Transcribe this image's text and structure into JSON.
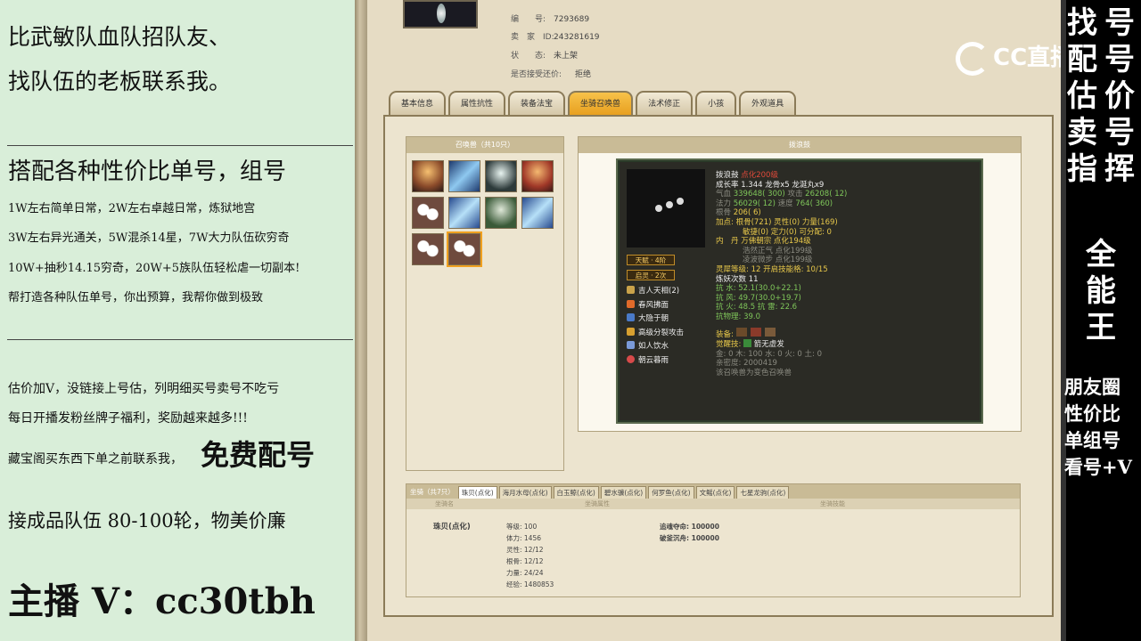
{
  "left_panel": {
    "line1": "比武敏队血队招队友、",
    "line2": "找队伍的老板联系我。",
    "section2_title": "搭配各种性价比单号，组号",
    "s2_l1": "1W左右简单日常，2W左右卓越日常，炼狱地宫",
    "s2_l2": "3W左右异光通关，5W混杀14星，7W大力队伍砍穷奇",
    "s2_l3": "10W+抽秒14.15穷奇，20W+5族队伍轻松虐一切副本!",
    "s2_l4": "帮打造各种队伍单号，你出预算，我帮你做到极致",
    "s3_l1": "估价加V，没链接上号估，列明细买号卖号不吃亏",
    "s3_l2": "每日开播发粉丝牌子福利，奖励越来越多!!!",
    "s3_l3a": "藏宝阁买东西下单之前联系我，",
    "s3_l3b": "免费配号",
    "s3_l4": "接成品队伍 80-100轮，物美价廉",
    "host": "主播 V：cc30tbh"
  },
  "game": {
    "info": [
      {
        "k": "编　　号:",
        "v": "7293689"
      },
      {
        "k": "卖　家　ID:",
        "v": "243281619"
      },
      {
        "k": "状　　态:",
        "v": "未上架"
      },
      {
        "k": "是否接受还价:",
        "v": "拒绝"
      }
    ],
    "tabs": [
      "基本信息",
      "属性抗性",
      "装备法宝",
      "坐骑召唤兽",
      "法术修正",
      "小孩",
      "外观道具"
    ],
    "pets_title": "召唤兽（共10只）",
    "detail_title": "拨浪鼓",
    "card": {
      "name": "拨浪鼓",
      "tag": "点化200级",
      "growth": "成长率 1.344  龙骨x5  龙涎丸x9",
      "hp_label": "气血",
      "hp": "339648( 300)",
      "atk_label": "攻击",
      "atk": "26208( 12)",
      "mp_label": "法力",
      "mp": "56029( 12)",
      "spd_label": "速度",
      "spd": "764( 360)",
      "int_label": "根骨",
      "int": "206( 6)",
      "points": "加点:   根骨(721) 灵性(0) 力量(169)",
      "points2": "敏捷(0) 定力(0) 可分配: 0",
      "inner": "内　丹  万佛朝宗 点化194级",
      "inner2": "浩然正气 点化199级",
      "inner3": "凌波微步 点化199级",
      "lingxi": "灵犀等级:   12  开启技能格:  10/15",
      "refine": "炼妖次数  11",
      "res1": "抗  水: 52.1(30.0+22.1)",
      "res2": "抗  风: 49.7(30.0+19.7)",
      "res3": "抗  火: 48.5  抗  雷: 22.6",
      "res4": "抗物理: 39.0",
      "equip_label": "装备:",
      "awake_label": "觉醒技:",
      "awake": "箭无虚发",
      "elements": "金: 0  木: 100  水: 0  火: 0  土: 0",
      "family": "亲密度: 2000419",
      "note": "该召唤兽为变色召唤兽",
      "chip1": "天赋 · 4阶",
      "chip2": "启灵 · 2次",
      "skills": [
        "吉人天相(2)",
        "春风拂面",
        "大隐于朝",
        "高级分裂攻击",
        "如人饮水",
        "朝云暮雨"
      ]
    },
    "mount": {
      "label": "坐骑（共7只）",
      "tabs": [
        "珠贝(点化)",
        "海月水母(点化)",
        "白玉鲸(点化)",
        "碧水骥(点化)",
        "何罗鱼(点化)",
        "文鳐(点化)",
        "七星龙驹(点化)"
      ],
      "head1": "坐骑名",
      "head2": "坐骑属性",
      "head3": "坐骑技能",
      "name": "珠贝(点化)",
      "attrs": [
        "等级: 100",
        "体力: 1456",
        "灵性: 12/12",
        "根骨: 12/12",
        "力量: 24/24",
        "经验: 1480853"
      ],
      "skills": [
        "追魂夺命: 100000",
        "破釜沉舟: 100000"
      ]
    }
  },
  "right_panel": {
    "col1": "找号配估卖指全能王",
    "col2": "号号价号挥",
    "lines": [
      "朋友圈",
      "性价比",
      "单组号",
      "看号+V"
    ]
  },
  "logo": "CC直播"
}
